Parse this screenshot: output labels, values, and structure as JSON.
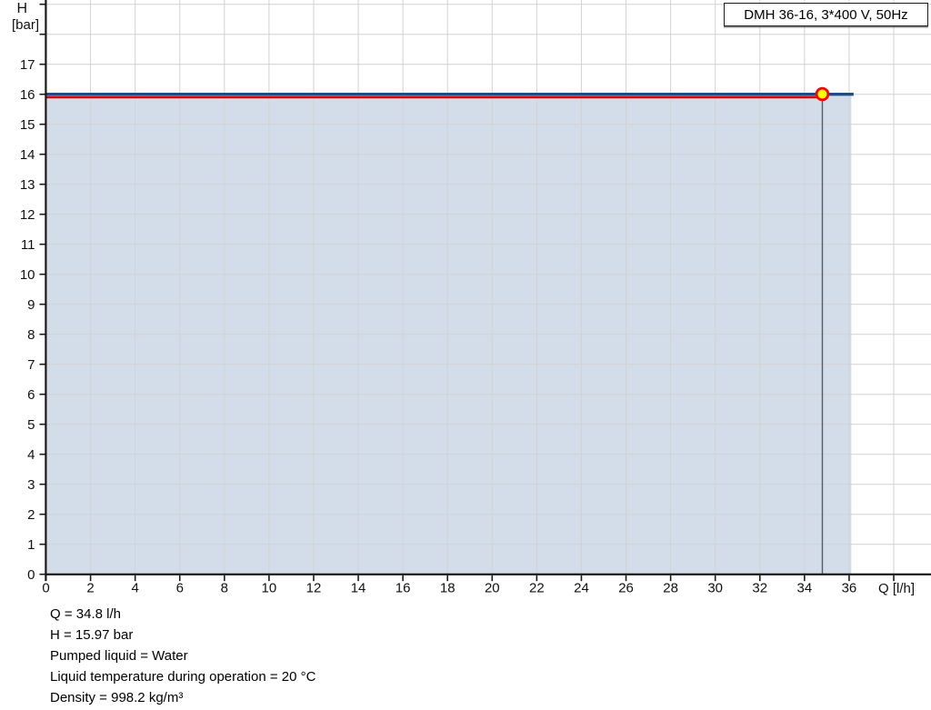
{
  "legend": {
    "label": "DMH 36-16, 3*400 V, 50Hz"
  },
  "axes": {
    "y_label_line1": "H",
    "y_label_line2": "[bar]",
    "x_label": "Q [l/h]"
  },
  "info": {
    "lines": [
      "Q = 34.8 l/h",
      "H = 15.97 bar",
      "Pumped liquid = Water",
      "Liquid temperature during operation = 20 °C",
      "Density = 998.2 kg/m³"
    ]
  },
  "chart_data": {
    "type": "line",
    "title": "DMH 36-16, 3*400 V, 50Hz",
    "xlabel": "Q [l/h]",
    "ylabel": "H [bar]",
    "xlim": [
      0,
      39.7
    ],
    "ylim": [
      0,
      19
    ],
    "x_ticks": [
      0,
      2,
      4,
      6,
      8,
      10,
      12,
      14,
      16,
      18,
      20,
      22,
      24,
      26,
      28,
      30,
      32,
      34,
      36
    ],
    "y_ticks": [
      0,
      1,
      2,
      3,
      4,
      5,
      6,
      7,
      8,
      9,
      10,
      11,
      12,
      13,
      14,
      15,
      16,
      17
    ],
    "grid": true,
    "grid_x_step": 2,
    "grid_x_max": 38,
    "grid_y_max": 19,
    "legend_position": "top-right",
    "series": [
      {
        "name": "qh-curve-line",
        "color": "#1a4e85",
        "width": 3.4,
        "points": [
          [
            0,
            16
          ],
          [
            36.2,
            16
          ]
        ]
      },
      {
        "name": "max-pressure-line",
        "color": "#e00000",
        "width": 2.4,
        "points": [
          [
            0,
            15.9
          ],
          [
            34.8,
            15.9
          ]
        ]
      }
    ],
    "fill_area": {
      "x_from": 0,
      "x_to": 36.1,
      "y_top": 16,
      "color": "#d2dde9"
    },
    "duty_point": {
      "q": 34.8,
      "h": 15.97,
      "marker_fill": "#ffff00",
      "marker_stroke": "#ff0000"
    },
    "drop_line_color": "#555c63",
    "grid_color": "#d2d2d2",
    "axis_color": "#1a1a1a"
  }
}
